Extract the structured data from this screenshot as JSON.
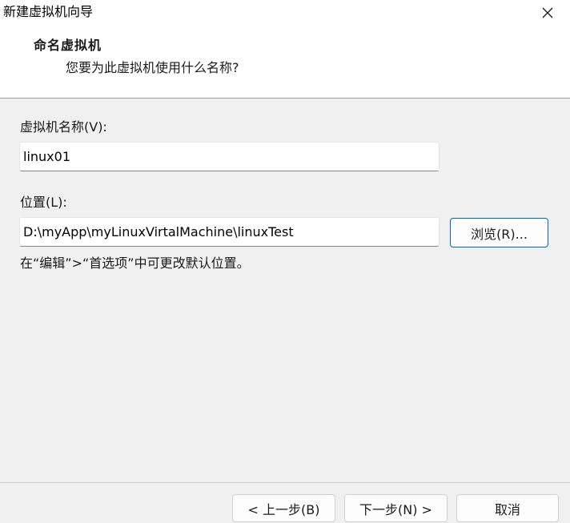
{
  "window": {
    "title": "新建虚拟机向导",
    "close_glyph": "✕"
  },
  "header": {
    "title": "命名虚拟机",
    "subtitle": "您要为此虚拟机使用什么名称?"
  },
  "form": {
    "vm_name_label": "虚拟机名称(V):",
    "vm_name_value": "linux01",
    "location_label": "位置(L):",
    "location_value": "D:\\myApp\\myLinuxVirtalMachine\\linuxTest",
    "browse_label": "浏览(R)...",
    "hint": "在“编辑”>“首选项”中可更改默认位置。"
  },
  "footer": {
    "back_label": "< 上一步(B)",
    "next_label": "下一步(N) >",
    "cancel_label": "取消"
  },
  "colors": {
    "accent": "#0067c0",
    "background": "#f0f0f0",
    "header_background": "#ffffff"
  },
  "icons": {
    "close": "close-icon"
  }
}
